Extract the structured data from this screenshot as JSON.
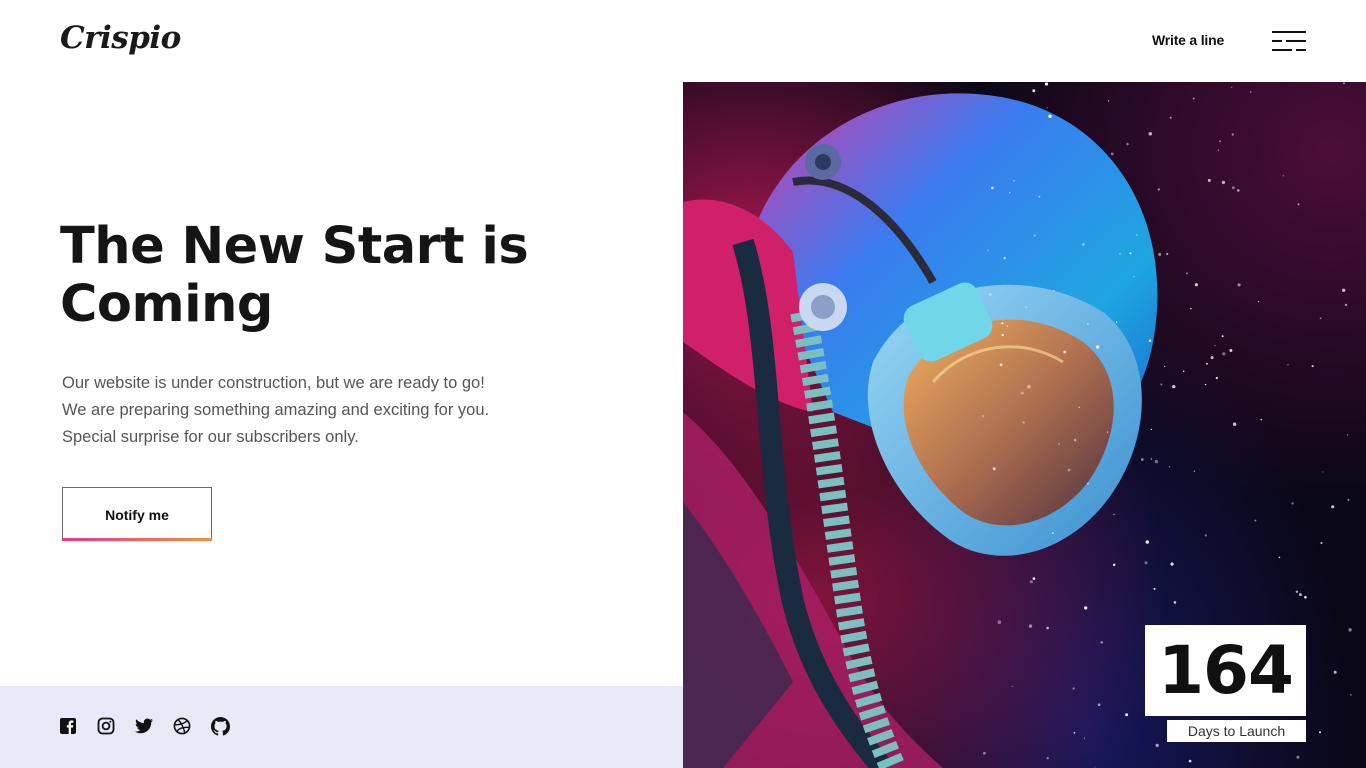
{
  "header": {
    "logo": "Crispio",
    "link_label": "Write a line",
    "menu_icon": "menu-icon"
  },
  "hero": {
    "title": "The New Start is Coming",
    "lines": [
      "Our website is under construction, but we are ready to go!",
      "We are preparing something amazing and exciting for you.",
      "Special surprise for our subscribers only."
    ],
    "button_label": "Notify me"
  },
  "social": [
    {
      "icon": "facebook-icon"
    },
    {
      "icon": "instagram-icon"
    },
    {
      "icon": "twitter-icon"
    },
    {
      "icon": "dribbble-icon"
    },
    {
      "icon": "github-icon"
    }
  ],
  "countdown": {
    "value": "164",
    "label": "Days to Launch"
  },
  "colors": {
    "gradient_start": "#e8368f",
    "gradient_end": "#f0923c",
    "footer_band": "#e7eaf6"
  }
}
